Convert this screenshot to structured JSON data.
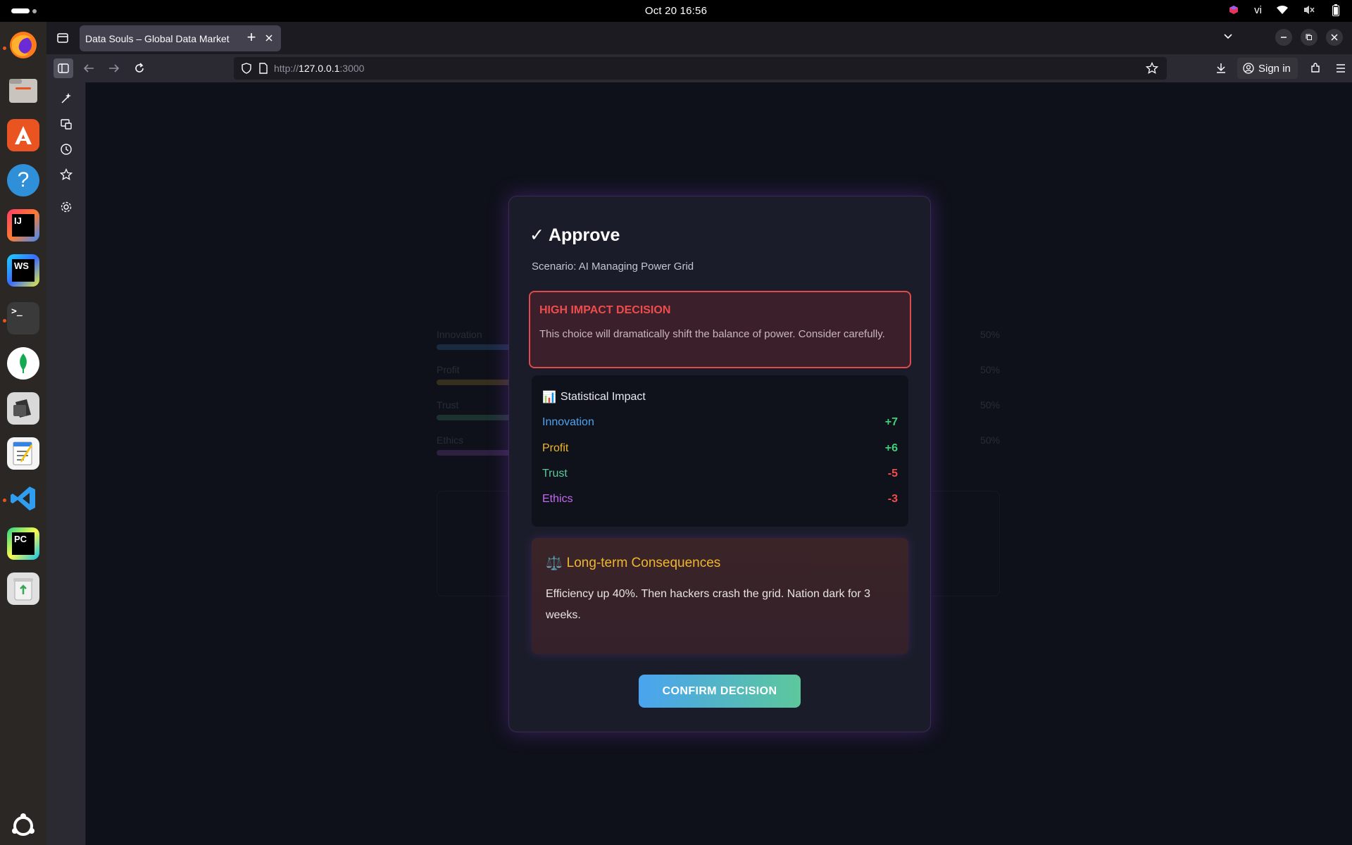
{
  "topbar": {
    "datetime": "Oct 20  16:56",
    "keyboard_layout": "vi"
  },
  "dock": {
    "apps": [
      "firefox-icon",
      "files-icon",
      "app-center-icon",
      "help-icon",
      "intellij-icon",
      "webstorm-icon",
      "terminal-icon",
      "mongodb-compass-icon",
      "screenshot-icon",
      "text-editor-icon",
      "vscode-icon",
      "pycharm-icon",
      "trash-icon",
      "ubuntu-apps-icon"
    ],
    "labels": {
      "help": "?",
      "intellij": "IJ",
      "webstorm": "WS",
      "terminal": ">_",
      "pycharm": "PC"
    }
  },
  "browser": {
    "tab_title": "Data Souls – Global Data Market",
    "url_scheme": "http://",
    "url_host": "127.0.0.1",
    "url_port": ":3000",
    "sign_in_label": "Sign in"
  },
  "background": {
    "stats": [
      {
        "label": "Innovation",
        "pct": "50%",
        "color": "#4aa3f0"
      },
      {
        "label": "Profit",
        "pct": "50%",
        "color": "#f0b52e"
      },
      {
        "label": "Trust",
        "pct": "50%",
        "color": "#5cc89b"
      },
      {
        "label": "Ethics",
        "pct": "50%",
        "color": "#c36af0"
      }
    ]
  },
  "modal": {
    "title": "✓ Approve",
    "scenario": "Scenario: AI Managing Power Grid",
    "alert": {
      "title": "HIGH IMPACT DECISION",
      "text": "This choice will dramatically shift the balance of power. Consider carefully."
    },
    "impact": {
      "icon": "📊",
      "title": "Statistical Impact",
      "stats": [
        {
          "name": "Innovation",
          "delta": "+7",
          "name_color": "#4aa3f0",
          "delta_color": "#3fd07a"
        },
        {
          "name": "Profit",
          "delta": "+6",
          "name_color": "#f0b52e",
          "delta_color": "#3fd07a"
        },
        {
          "name": "Trust",
          "delta": "-5",
          "name_color": "#5cc89b",
          "delta_color": "#ef4d4d"
        },
        {
          "name": "Ethics",
          "delta": "-3",
          "name_color": "#c36af0",
          "delta_color": "#ef4d4d"
        }
      ]
    },
    "consequences": {
      "icon": "⚖️",
      "title": "Long-term Consequences",
      "text": "Efficiency up 40%. Then hackers crash the grid. Nation dark for 3 weeks."
    },
    "confirm_label": "CONFIRM DECISION"
  }
}
